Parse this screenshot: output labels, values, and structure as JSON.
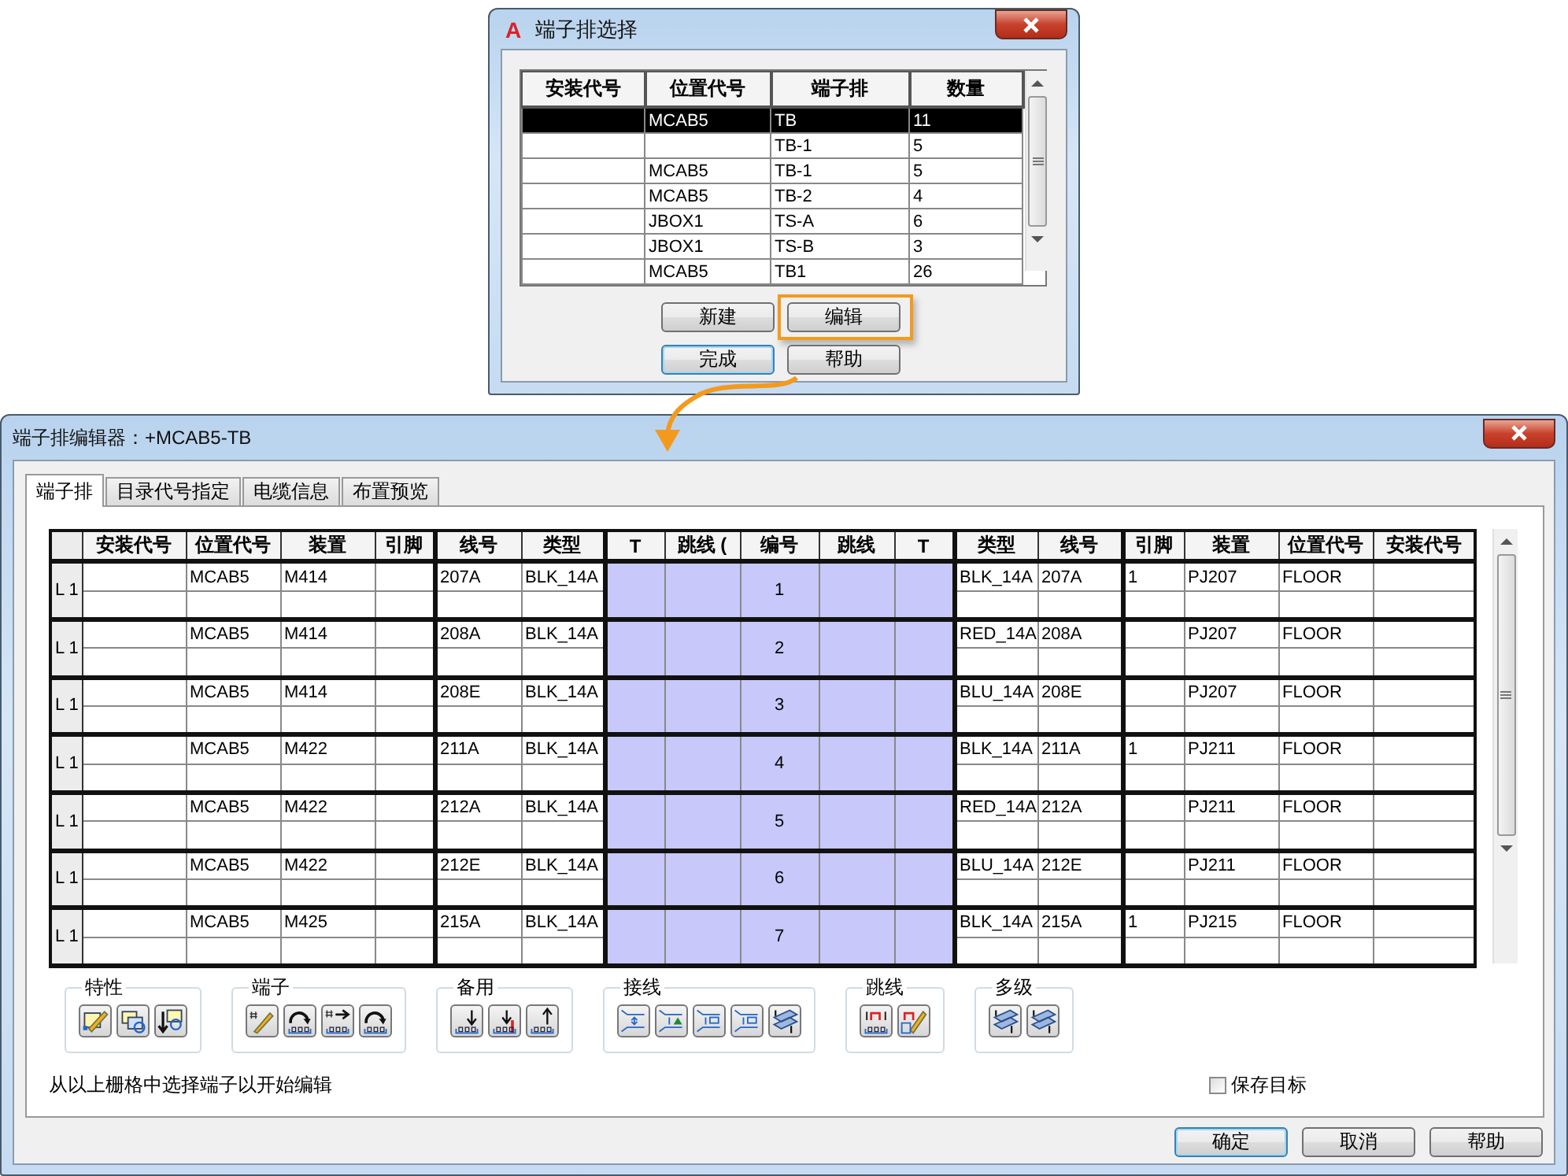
{
  "selector_dialog": {
    "logo": "A",
    "title": "端子排选择",
    "columns": [
      "安装代号",
      "位置代号",
      "端子排",
      "数量"
    ],
    "rows": [
      {
        "location": "MCAB5",
        "strip": "TB",
        "quantity": "11",
        "selected": true
      },
      {
        "strip": "TB-1",
        "quantity": "5",
        "selected": false
      },
      {
        "location": "MCAB5",
        "strip": "TB-1",
        "quantity": "5",
        "selected": false
      },
      {
        "location": "MCAB5",
        "strip": "TB-2",
        "quantity": "4",
        "selected": false
      },
      {
        "location": "JBOX1",
        "strip": "TS-A",
        "quantity": "6",
        "selected": false
      },
      {
        "location": "JBOX1",
        "strip": "TS-B",
        "quantity": "3",
        "selected": false
      },
      {
        "location": "MCAB5",
        "strip": "TB1",
        "quantity": "26",
        "selected": false
      }
    ],
    "buttons": [
      {
        "label": "新建",
        "default": false,
        "highlighted": false
      },
      {
        "label": "编辑",
        "default": false,
        "highlighted": true
      },
      {
        "label": "完成",
        "default": true,
        "highlighted": false
      },
      {
        "label": "帮助",
        "default": false,
        "highlighted": false
      }
    ]
  },
  "editor_dialog": {
    "title": "端子排编辑器：+MCAB5-TB",
    "tabs": [
      {
        "label": "端子排",
        "selected": true
      },
      {
        "label": "目录代号指定",
        "selected": false
      },
      {
        "label": "电缆信息",
        "selected": false
      },
      {
        "label": "布置预览",
        "selected": false
      }
    ],
    "grid": {
      "left_columns": [
        "安装代号",
        "位置代号",
        "装置",
        "引脚",
        "线号",
        "类型"
      ],
      "middle_columns": [
        "T",
        "跳线 (",
        "编号",
        "跳线",
        "T"
      ],
      "right_columns": [
        "类型",
        "线号",
        "引脚",
        "装置",
        "位置代号",
        "安装代号"
      ],
      "rows": [
        {
          "label": "L 1",
          "left": {
            "location": "MCAB5",
            "device": "M414",
            "wire": "207A",
            "type": "BLK_14A"
          },
          "number": "1",
          "right": {
            "type": "BLK_14A",
            "wire": "207A",
            "pin": "1",
            "device": "PJ207",
            "location": "FLOOR"
          }
        },
        {
          "label": "L 1",
          "left": {
            "location": "MCAB5",
            "device": "M414",
            "wire": "208A",
            "type": "BLK_14A"
          },
          "number": "2",
          "right": {
            "type": "RED_14A",
            "wire": "208A",
            "device": "PJ207",
            "location": "FLOOR"
          }
        },
        {
          "label": "L 1",
          "left": {
            "location": "MCAB5",
            "device": "M414",
            "wire": "208E",
            "type": "BLK_14A"
          },
          "number": "3",
          "right": {
            "type": "BLU_14A",
            "wire": "208E",
            "device": "PJ207",
            "location": "FLOOR"
          }
        },
        {
          "label": "L 1",
          "left": {
            "location": "MCAB5",
            "device": "M422",
            "wire": "211A",
            "type": "BLK_14A"
          },
          "number": "4",
          "right": {
            "type": "BLK_14A",
            "wire": "211A",
            "pin": "1",
            "device": "PJ211",
            "location": "FLOOR"
          }
        },
        {
          "label": "L 1",
          "left": {
            "location": "MCAB5",
            "device": "M422",
            "wire": "212A",
            "type": "BLK_14A"
          },
          "number": "5",
          "right": {
            "type": "RED_14A",
            "wire": "212A",
            "device": "PJ211",
            "location": "FLOOR"
          }
        },
        {
          "label": "L 1",
          "left": {
            "location": "MCAB5",
            "device": "M422",
            "wire": "212E",
            "type": "BLK_14A"
          },
          "number": "6",
          "right": {
            "type": "BLU_14A",
            "wire": "212E",
            "device": "PJ211",
            "location": "FLOOR"
          }
        },
        {
          "label": "L 1",
          "left": {
            "location": "MCAB5",
            "device": "M425",
            "wire": "215A",
            "type": "BLK_14A"
          },
          "number": "7",
          "right": {
            "type": "BLK_14A",
            "wire": "215A",
            "pin": "1",
            "device": "PJ215",
            "location": "FLOOR"
          }
        }
      ]
    },
    "tool_groups": [
      {
        "label": "特性",
        "tools": [
          {
            "kind": "pencil"
          },
          {
            "kind": "boxes"
          },
          {
            "kind": "arrow-boxes"
          }
        ]
      },
      {
        "label": "端子",
        "tools": [
          {
            "kind": "hash-pencil"
          },
          {
            "kind": "arc-terminals"
          },
          {
            "kind": "hash-terminals"
          },
          {
            "kind": "arc-terminals"
          }
        ]
      },
      {
        "label": "备用",
        "tools": [
          {
            "kind": "down-terminals"
          },
          {
            "kind": "red-terminals"
          },
          {
            "kind": "up-terminals"
          }
        ]
      },
      {
        "label": "接线",
        "tools": [
          {
            "kind": "wire"
          },
          {
            "kind": "wire-plus"
          },
          {
            "kind": "wire-list"
          },
          {
            "kind": "wire-list"
          },
          {
            "kind": "layers"
          }
        ]
      },
      {
        "label": "跳线",
        "tools": [
          {
            "kind": "jumper"
          },
          {
            "kind": "jumper-pencil"
          }
        ]
      },
      {
        "label": "多级",
        "tools": [
          {
            "kind": "layers"
          },
          {
            "kind": "layers"
          }
        ]
      }
    ],
    "status": "从以上栅格中选择端子以开始编辑",
    "save_target": {
      "label": "保存目标",
      "checked": false
    },
    "buttons": [
      {
        "label": "确定",
        "default": true
      },
      {
        "label": "取消",
        "default": false
      },
      {
        "label": "帮助",
        "default": false
      }
    ]
  }
}
